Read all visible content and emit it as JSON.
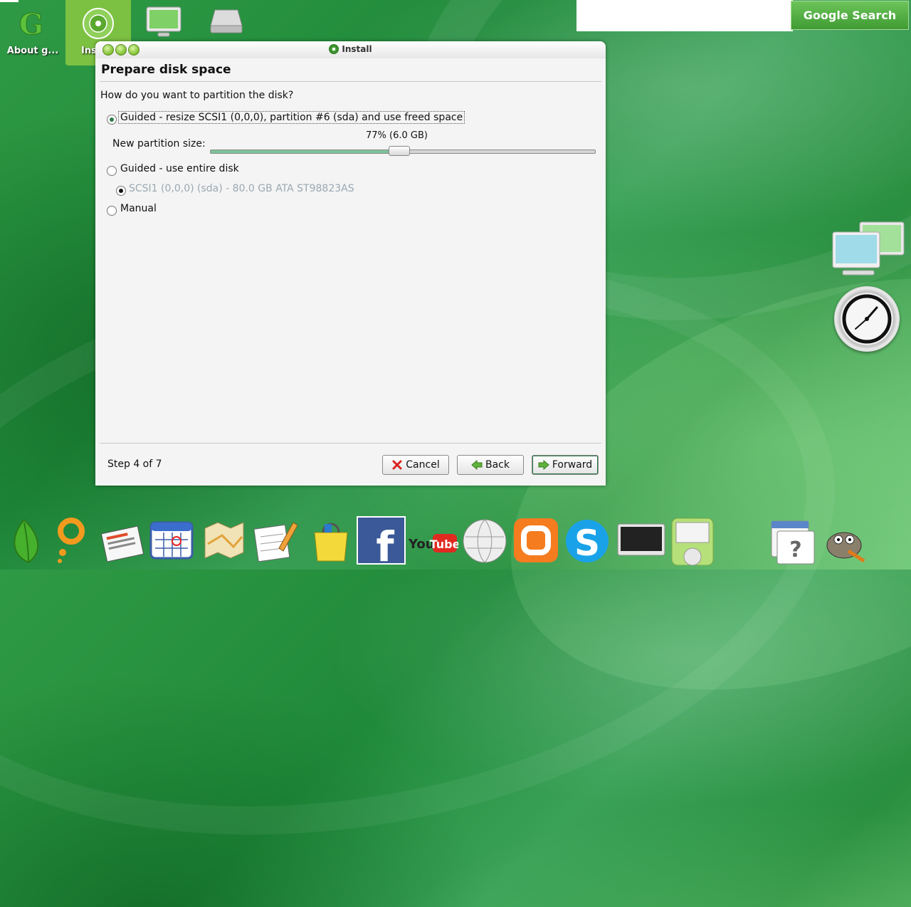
{
  "desktop": {
    "icons": [
      {
        "label": "About g..."
      },
      {
        "label": "Ins"
      },
      {
        "label": ""
      },
      {
        "label": ""
      }
    ]
  },
  "search": {
    "placeholder": "",
    "button_label": "Google Search"
  },
  "window": {
    "title": "Install",
    "heading": "Prepare disk space",
    "question": "How do you want to partition the disk?",
    "options": {
      "guided_resize": "Guided - resize SCSI1 (0,0,0), partition #6 (sda) and use freed space",
      "new_partition_label": "New partition size:",
      "new_partition_value": "77% (6.0 GB)",
      "slider_percent": 0.49,
      "guided_entire": "Guided - use entire disk",
      "disk_choice": "SCSI1 (0,0,0) (sda) - 80.0 GB ATA ST98823AS",
      "manual": "Manual"
    },
    "footer": {
      "step": "Step 4 of 7",
      "cancel": "Cancel",
      "back": "Back",
      "forward": "Forward"
    }
  },
  "colors": {
    "accent": "#2d7a4a",
    "desktop_green": "#2a8f40",
    "active_tile": "#7cc142"
  },
  "dock": [
    "leaf-icon",
    "search-ring-icon",
    "news-icon",
    "calendar-icon",
    "maps-icon",
    "docs-icon",
    "shopping-icon",
    "facebook-icon",
    "youtube-icon",
    "wikipedia-icon",
    "blogger-icon",
    "skype-icon",
    "tv-icon",
    "ipod-icon",
    "help-icon",
    "gimp-icon"
  ]
}
